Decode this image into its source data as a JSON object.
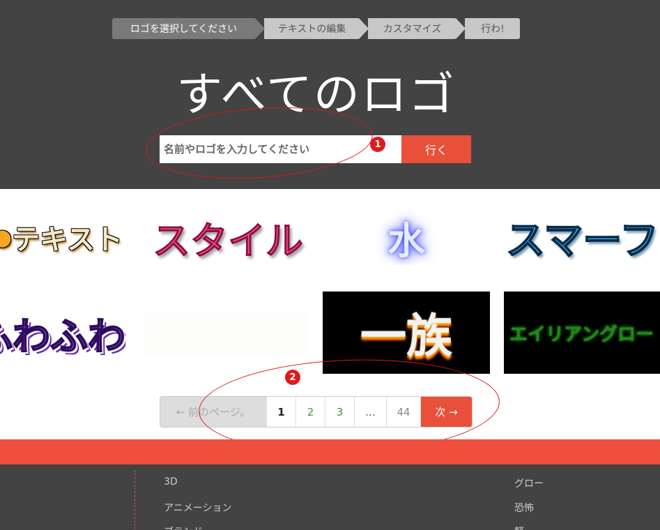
{
  "steps": [
    "ロゴを選択してください",
    "テキストの編集",
    "カスタマイズ",
    "行わ!"
  ],
  "page_title": "すべてのロゴ",
  "search": {
    "placeholder": "名前やロゴを入力してください",
    "button": "行く"
  },
  "annotations": {
    "badge1": "1",
    "badge2": "2"
  },
  "logos": {
    "r1": [
      "テキスト",
      "スタイル",
      "水",
      "スマーフ"
    ],
    "r2": [
      "ふわふわ",
      "",
      "一族",
      "エイリアングロー"
    ]
  },
  "pagination": {
    "prev": "← 前のページ。",
    "current": "1",
    "p2": "2",
    "p3": "3",
    "ellipsis": "…",
    "last": "44",
    "next": "次 →"
  },
  "footer": {
    "left": [
      "3D",
      "アニメーション",
      "ブランド"
    ],
    "right": [
      "グロー",
      "恐怖",
      "軽"
    ]
  },
  "colors": {
    "header_bg": "#434343",
    "accent": "#e8503a",
    "annotation": "#d81818"
  }
}
